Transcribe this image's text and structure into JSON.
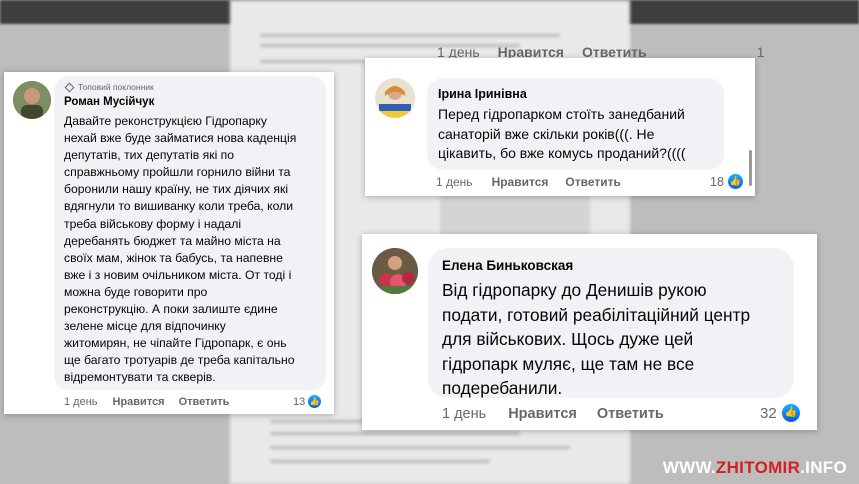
{
  "background": {
    "top_edge_actions": {
      "time": "1 день",
      "like": "Нравится",
      "reply": "Ответить",
      "count": "1"
    }
  },
  "comments": [
    {
      "badge": "Топовий поклонник",
      "author": "Роман Мусійчук",
      "text": "Давайте реконструкцією Гідропарку\nнехай вже буде займатися нова каденція\nдепутатів, тих депутатів які по\nсправжньому пройшли горнило війни та\nборонили нашу країну, не тих діячих які\nвдягнули то вишиванку коли треба, коли\nтреба військову форму і надалі\nдеребанять бюджет та майно міста на\nсвоїх мам, жінок та бабусь, та напевне\nвже і з новим очільником міста. От тоді і\nможна буде говорити про\nреконструкцію. А поки залиште єдине\nзелене місце для відпочинку\nжитомирян, не чіпайте Гідропарк, є онь\nще багато тротуарів де треба капітально\nвідремонтувати та скверів.",
      "time": "1 день",
      "like_label": "Нравится",
      "reply_label": "Ответить",
      "likes": "13"
    },
    {
      "author": "Ірина Іринівна",
      "text": "Перед гідропарком стоїть занедбаний\nсанаторій вже скільки років(((. Не\nцікавить, бо вже комусь проданий?((((",
      "time": "1 день",
      "like_label": "Нравится",
      "reply_label": "Ответить",
      "likes": "18"
    },
    {
      "author": "Елена Биньковская",
      "text": "Від гідропарку до Денишів рукою\nподати, готовий реабілітаційний центр\nдля військових. Щось дуже цей\nгідропарк муляє, ще там не все\nподеребанили.",
      "time": "1 день",
      "like_label": "Нравится",
      "reply_label": "Ответить",
      "likes": "32"
    }
  ],
  "watermark": {
    "prefix": "WWW.",
    "brand": "ZHITOMIR",
    "suffix": ".INFO"
  },
  "colors": {
    "bubble": "#f0f2f5",
    "like_blue": "#0866ff",
    "watermark_red": "#d32020"
  }
}
